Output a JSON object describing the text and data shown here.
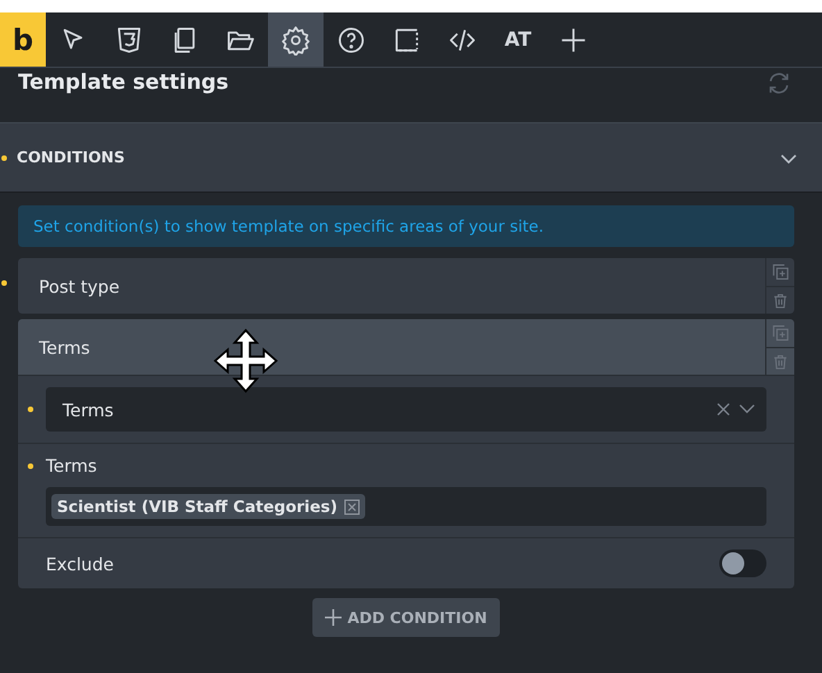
{
  "toolbar": [
    {
      "kind": "logo",
      "text": "b"
    },
    {
      "kind": "icon",
      "selected": false
    },
    {
      "kind": "icon",
      "selected": false
    },
    {
      "kind": "icon",
      "selected": false
    },
    {
      "kind": "icon",
      "selected": false
    },
    {
      "kind": "icon",
      "selected": true
    },
    {
      "kind": "icon",
      "selected": false
    },
    {
      "kind": "icon",
      "selected": false
    },
    {
      "kind": "icon",
      "selected": false
    },
    {
      "kind": "text",
      "text": "AT",
      "selected": false
    },
    {
      "kind": "icon",
      "selected": false
    }
  ],
  "panel": {
    "title": "Template settings"
  },
  "section": {
    "title": "CONDITIONS",
    "expanded": true,
    "notice": "Set condition(s) to show template on specific areas of your site.",
    "conditions": [
      {
        "title": "Post type",
        "expanded": false
      },
      {
        "title": "Terms",
        "expanded": true,
        "select_value": "Terms",
        "terms_label": "Terms",
        "tags": [
          "Scientist (VIB Staff Categories)"
        ],
        "exclude_label": "Exclude",
        "exclude_on": false
      }
    ],
    "add_button": "ADD CONDITION"
  }
}
